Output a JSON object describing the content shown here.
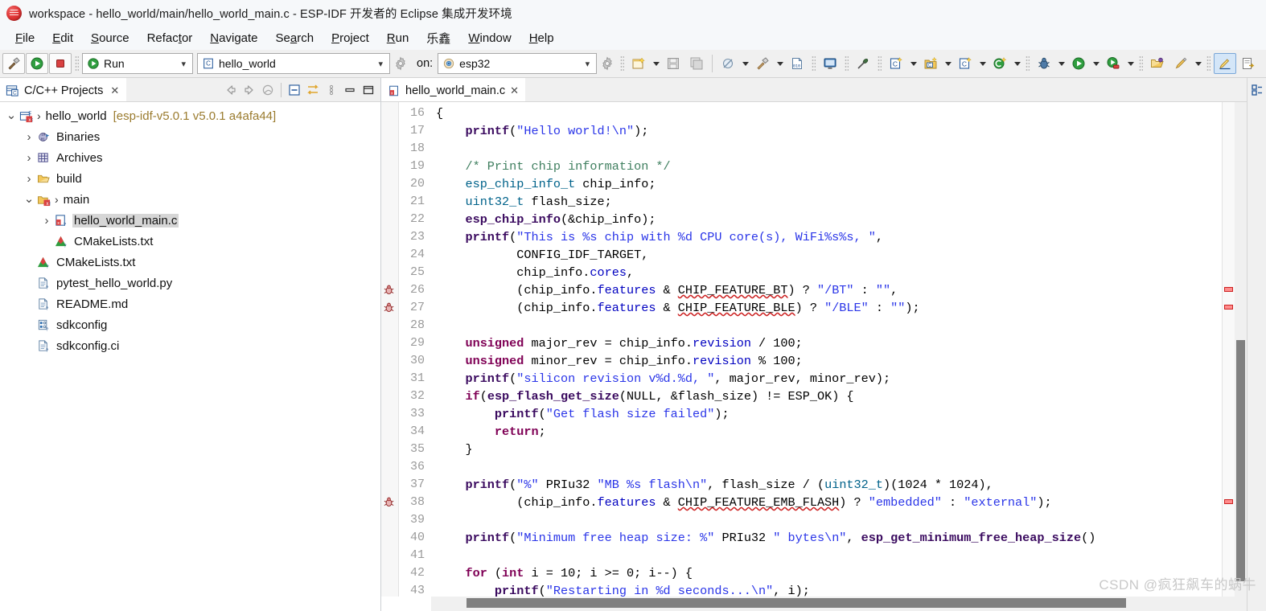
{
  "window": {
    "title": "workspace - hello_world/main/hello_world_main.c - ESP-IDF 开发者的 Eclipse 集成开发环境",
    "app_icon": "eclipse-logo-icon"
  },
  "menubar": {
    "items": [
      {
        "label": "File",
        "mnemonic": "F"
      },
      {
        "label": "Edit",
        "mnemonic": "E"
      },
      {
        "label": "Source",
        "mnemonic": "S"
      },
      {
        "label": "Refactor",
        "mnemonic": "t"
      },
      {
        "label": "Navigate",
        "mnemonic": "N"
      },
      {
        "label": "Search",
        "mnemonic": "a"
      },
      {
        "label": "Project",
        "mnemonic": "P"
      },
      {
        "label": "Run",
        "mnemonic": "R"
      },
      {
        "label": "乐鑫",
        "mnemonic": ""
      },
      {
        "label": "Window",
        "mnemonic": "W"
      },
      {
        "label": "Help",
        "mnemonic": "H"
      }
    ]
  },
  "toolbar": {
    "build_button_name": "build-hammer-button",
    "launch_button_name": "launch-run-button",
    "stop_button_name": "stop-button",
    "mode_combo": {
      "value": "Run",
      "icon": "run-green-play-icon"
    },
    "target_combo": {
      "value": "hello_world",
      "icon": "c-project-icon"
    },
    "on_label": "on:",
    "device_combo": {
      "value": "esp32",
      "icon": "chip-target-icon"
    },
    "icons": [
      "new-wizard-icon",
      "save-icon",
      "save-all-icon",
      "skip-breakpoints-icon",
      "build-hammer-icon",
      "binary-010-icon",
      "console-monitor-icon",
      "disconnect-icon",
      "new-c-project-icon",
      "new-c-folder-icon",
      "new-c-file-icon",
      "new-c-class-icon",
      "debug-bug-icon",
      "run-icon",
      "coverage-icon",
      "open-perspective-icon",
      "highlight-pen-icon",
      "toggle-mark-occurrences-icon",
      "next-annotation-icon",
      "show-whitespace-icon",
      "pilcrow-icon",
      "save-as-icon"
    ]
  },
  "project_view": {
    "tab_label": "C/C++ Projects",
    "tab_icon": "c-projects-icon",
    "toolbar_icons": [
      "back-arrow-icon",
      "forward-arrow-icon",
      "home-icon",
      "collapse-all-icon",
      "link-with-editor-icon",
      "view-menu-icon",
      "minimize-icon",
      "maximize-icon"
    ],
    "tree": [
      {
        "depth": 0,
        "twisty": "expanded",
        "icon": "c-project-icon",
        "chevron": true,
        "label": "hello_world",
        "suffix": "[esp-idf-v5.0.1 v5.0.1 a4afa44]",
        "selected": false
      },
      {
        "depth": 1,
        "twisty": "collapsed",
        "icon": "binaries-icon",
        "chevron": false,
        "label": "Binaries",
        "suffix": "",
        "selected": false
      },
      {
        "depth": 1,
        "twisty": "collapsed",
        "icon": "archives-icon",
        "chevron": false,
        "label": "Archives",
        "suffix": "",
        "selected": false
      },
      {
        "depth": 1,
        "twisty": "collapsed",
        "icon": "folder-icon",
        "chevron": false,
        "label": "build",
        "suffix": "",
        "selected": false
      },
      {
        "depth": 1,
        "twisty": "expanded",
        "icon": "c-folder-icon",
        "chevron": true,
        "label": "main",
        "suffix": "",
        "selected": false
      },
      {
        "depth": 2,
        "twisty": "collapsed",
        "icon": "c-source-file-icon",
        "chevron": false,
        "label": "hello_world_main.c",
        "suffix": "",
        "selected": true
      },
      {
        "depth": 2,
        "twisty": "none",
        "icon": "cmake-icon",
        "chevron": false,
        "label": "CMakeLists.txt",
        "suffix": "",
        "selected": false
      },
      {
        "depth": 1,
        "twisty": "none",
        "icon": "cmake-icon",
        "chevron": false,
        "label": "CMakeLists.txt",
        "suffix": "",
        "selected": false
      },
      {
        "depth": 1,
        "twisty": "none",
        "icon": "text-file-icon",
        "chevron": false,
        "label": "pytest_hello_world.py",
        "suffix": "",
        "selected": false
      },
      {
        "depth": 1,
        "twisty": "none",
        "icon": "text-file-icon",
        "chevron": false,
        "label": "README.md",
        "suffix": "",
        "selected": false
      },
      {
        "depth": 1,
        "twisty": "none",
        "icon": "config-file-icon",
        "chevron": false,
        "label": "sdkconfig",
        "suffix": "",
        "selected": false
      },
      {
        "depth": 1,
        "twisty": "none",
        "icon": "text-file-icon",
        "chevron": false,
        "label": "sdkconfig.ci",
        "suffix": "",
        "selected": false
      }
    ]
  },
  "editor": {
    "tab_label": "hello_world_main.c",
    "tab_icon": "c-source-file-icon",
    "first_line": 16,
    "last_line": 43,
    "error_lines": [
      26,
      27,
      38
    ],
    "lines": [
      {
        "no": 16,
        "tokens": [
          {
            "t": "pln",
            "v": "{"
          }
        ]
      },
      {
        "no": 17,
        "tokens": [
          {
            "t": "pln",
            "v": "    "
          },
          {
            "t": "fn",
            "v": "printf"
          },
          {
            "t": "pln",
            "v": "("
          },
          {
            "t": "str",
            "v": "\"Hello world!\\n\""
          },
          {
            "t": "pln",
            "v": ");"
          }
        ]
      },
      {
        "no": 18,
        "tokens": []
      },
      {
        "no": 19,
        "tokens": [
          {
            "t": "pln",
            "v": "    "
          },
          {
            "t": "cmt",
            "v": "/* Print chip information */"
          }
        ]
      },
      {
        "no": 20,
        "tokens": [
          {
            "t": "pln",
            "v": "    "
          },
          {
            "t": "typ",
            "v": "esp_chip_info_t"
          },
          {
            "t": "pln",
            "v": " chip_info;"
          }
        ]
      },
      {
        "no": 21,
        "tokens": [
          {
            "t": "pln",
            "v": "    "
          },
          {
            "t": "typ",
            "v": "uint32_t"
          },
          {
            "t": "pln",
            "v": " flash_size;"
          }
        ]
      },
      {
        "no": 22,
        "tokens": [
          {
            "t": "pln",
            "v": "    "
          },
          {
            "t": "fn",
            "v": "esp_chip_info"
          },
          {
            "t": "pln",
            "v": "(&chip_info);"
          }
        ]
      },
      {
        "no": 23,
        "tokens": [
          {
            "t": "pln",
            "v": "    "
          },
          {
            "t": "fn",
            "v": "printf"
          },
          {
            "t": "pln",
            "v": "("
          },
          {
            "t": "str",
            "v": "\"This is %s chip with %d CPU core(s), WiFi%s%s, \""
          },
          {
            "t": "pln",
            "v": ","
          }
        ]
      },
      {
        "no": 24,
        "tokens": [
          {
            "t": "pln",
            "v": "           CONFIG_IDF_TARGET,"
          }
        ]
      },
      {
        "no": 25,
        "tokens": [
          {
            "t": "pln",
            "v": "           chip_info."
          },
          {
            "t": "fld",
            "v": "cores"
          },
          {
            "t": "pln",
            "v": ","
          }
        ]
      },
      {
        "no": 26,
        "tokens": [
          {
            "t": "pln",
            "v": "           (chip_info."
          },
          {
            "t": "fld",
            "v": "features"
          },
          {
            "t": "pln",
            "v": " & "
          },
          {
            "t": "sq",
            "v": "CHIP_FEATURE_BT"
          },
          {
            "t": "pln",
            "v": ") ? "
          },
          {
            "t": "str",
            "v": "\"/BT\""
          },
          {
            "t": "pln",
            "v": " : "
          },
          {
            "t": "str",
            "v": "\"\""
          },
          {
            "t": "pln",
            "v": ","
          }
        ]
      },
      {
        "no": 27,
        "tokens": [
          {
            "t": "pln",
            "v": "           (chip_info."
          },
          {
            "t": "fld",
            "v": "features"
          },
          {
            "t": "pln",
            "v": " & "
          },
          {
            "t": "sq",
            "v": "CHIP_FEATURE_BLE"
          },
          {
            "t": "pln",
            "v": ") ? "
          },
          {
            "t": "str",
            "v": "\"/BLE\""
          },
          {
            "t": "pln",
            "v": " : "
          },
          {
            "t": "str",
            "v": "\"\""
          },
          {
            "t": "pln",
            "v": ");"
          }
        ]
      },
      {
        "no": 28,
        "tokens": []
      },
      {
        "no": 29,
        "tokens": [
          {
            "t": "pln",
            "v": "    "
          },
          {
            "t": "kw",
            "v": "unsigned"
          },
          {
            "t": "pln",
            "v": " major_rev = chip_info."
          },
          {
            "t": "fld",
            "v": "revision"
          },
          {
            "t": "pln",
            "v": " / 100;"
          }
        ]
      },
      {
        "no": 30,
        "tokens": [
          {
            "t": "pln",
            "v": "    "
          },
          {
            "t": "kw",
            "v": "unsigned"
          },
          {
            "t": "pln",
            "v": " minor_rev = chip_info."
          },
          {
            "t": "fld",
            "v": "revision"
          },
          {
            "t": "pln",
            "v": " % 100;"
          }
        ]
      },
      {
        "no": 31,
        "tokens": [
          {
            "t": "pln",
            "v": "    "
          },
          {
            "t": "fn",
            "v": "printf"
          },
          {
            "t": "pln",
            "v": "("
          },
          {
            "t": "str",
            "v": "\"silicon revision v%d.%d, \""
          },
          {
            "t": "pln",
            "v": ", major_rev, minor_rev);"
          }
        ]
      },
      {
        "no": 32,
        "tokens": [
          {
            "t": "pln",
            "v": "    "
          },
          {
            "t": "kw",
            "v": "if"
          },
          {
            "t": "pln",
            "v": "("
          },
          {
            "t": "fn",
            "v": "esp_flash_get_size"
          },
          {
            "t": "pln",
            "v": "(NULL, &flash_size) != ESP_OK) {"
          }
        ]
      },
      {
        "no": 33,
        "tokens": [
          {
            "t": "pln",
            "v": "        "
          },
          {
            "t": "fn",
            "v": "printf"
          },
          {
            "t": "pln",
            "v": "("
          },
          {
            "t": "str",
            "v": "\"Get flash size failed\""
          },
          {
            "t": "pln",
            "v": ");"
          }
        ]
      },
      {
        "no": 34,
        "tokens": [
          {
            "t": "pln",
            "v": "        "
          },
          {
            "t": "kw",
            "v": "return"
          },
          {
            "t": "pln",
            "v": ";"
          }
        ]
      },
      {
        "no": 35,
        "tokens": [
          {
            "t": "pln",
            "v": "    }"
          }
        ]
      },
      {
        "no": 36,
        "tokens": []
      },
      {
        "no": 37,
        "tokens": [
          {
            "t": "pln",
            "v": "    "
          },
          {
            "t": "fn",
            "v": "printf"
          },
          {
            "t": "pln",
            "v": "("
          },
          {
            "t": "str",
            "v": "\"%\""
          },
          {
            "t": "pln",
            "v": " PRIu32 "
          },
          {
            "t": "str",
            "v": "\"MB %s flash\\n\""
          },
          {
            "t": "pln",
            "v": ", flash_size / ("
          },
          {
            "t": "typ",
            "v": "uint32_t"
          },
          {
            "t": "pln",
            "v": ")(1024 * 1024),"
          }
        ]
      },
      {
        "no": 38,
        "tokens": [
          {
            "t": "pln",
            "v": "           (chip_info."
          },
          {
            "t": "fld",
            "v": "features"
          },
          {
            "t": "pln",
            "v": " & "
          },
          {
            "t": "sq",
            "v": "CHIP_FEATURE_EMB_FLASH"
          },
          {
            "t": "pln",
            "v": ") ? "
          },
          {
            "t": "str",
            "v": "\"embedded\""
          },
          {
            "t": "pln",
            "v": " : "
          },
          {
            "t": "str",
            "v": "\"external\""
          },
          {
            "t": "pln",
            "v": ");"
          }
        ]
      },
      {
        "no": 39,
        "tokens": []
      },
      {
        "no": 40,
        "tokens": [
          {
            "t": "pln",
            "v": "    "
          },
          {
            "t": "fn",
            "v": "printf"
          },
          {
            "t": "pln",
            "v": "("
          },
          {
            "t": "str",
            "v": "\"Minimum free heap size: %\""
          },
          {
            "t": "pln",
            "v": " PRIu32 "
          },
          {
            "t": "str",
            "v": "\" bytes\\n\""
          },
          {
            "t": "pln",
            "v": ", "
          },
          {
            "t": "fn",
            "v": "esp_get_minimum_free_heap_size"
          },
          {
            "t": "pln",
            "v": "()"
          }
        ]
      },
      {
        "no": 41,
        "tokens": []
      },
      {
        "no": 42,
        "tokens": [
          {
            "t": "pln",
            "v": "    "
          },
          {
            "t": "kw",
            "v": "for"
          },
          {
            "t": "pln",
            "v": " ("
          },
          {
            "t": "kw",
            "v": "int"
          },
          {
            "t": "pln",
            "v": " i = 10; i >= 0; i--) {"
          }
        ]
      },
      {
        "no": 43,
        "tokens": [
          {
            "t": "pln",
            "v": "        "
          },
          {
            "t": "fn",
            "v": "printf"
          },
          {
            "t": "pln",
            "v": "("
          },
          {
            "t": "str",
            "v": "\"Restarting in %d seconds...\\n\""
          },
          {
            "t": "pln",
            "v": ", i);"
          }
        ]
      }
    ]
  },
  "watermark": "CSDN @疯狂飙车的蜗牛",
  "colors": {
    "keyword": "#7f0055",
    "function": "#3a0a5f",
    "string": "#2a35e8",
    "comment": "#3f7f5f",
    "type": "#00628a",
    "field": "#0000c0",
    "error": "#cc2222",
    "selection": "#d6d6d6",
    "toolbar_bg": "#f0f0f0",
    "titlebar_bg": "#f6f8fa"
  }
}
